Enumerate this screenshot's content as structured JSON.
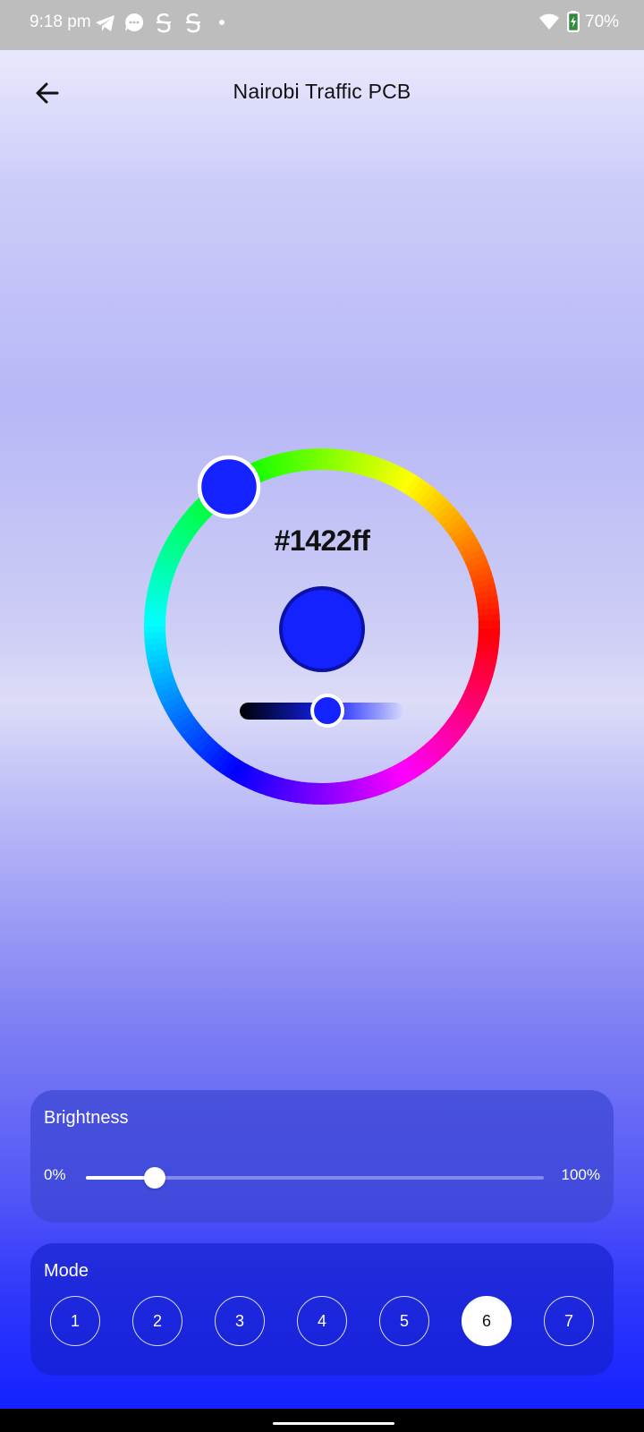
{
  "status_bar": {
    "time": "9:18 pm",
    "icons": [
      "telegram-icon",
      "messages-icon",
      "s-app-icon",
      "s-app-icon",
      "dot-icon",
      "wifi-icon",
      "battery-charging-icon"
    ],
    "battery": "70%"
  },
  "app_bar": {
    "title": "Nairobi Traffic PCB",
    "back_icon": "arrow-back-icon"
  },
  "color_picker": {
    "hex": "#1422ff",
    "selected_color": "#1422ff",
    "saturation_level": 0.54
  },
  "brightness": {
    "label": "Brightness",
    "min_label": "0%",
    "max_label": "100%",
    "value": 0.15
  },
  "mode": {
    "label": "Mode",
    "options": [
      "1",
      "2",
      "3",
      "4",
      "5",
      "6",
      "7"
    ],
    "selected": "6"
  },
  "colors": {
    "accent": "#1422ff"
  }
}
